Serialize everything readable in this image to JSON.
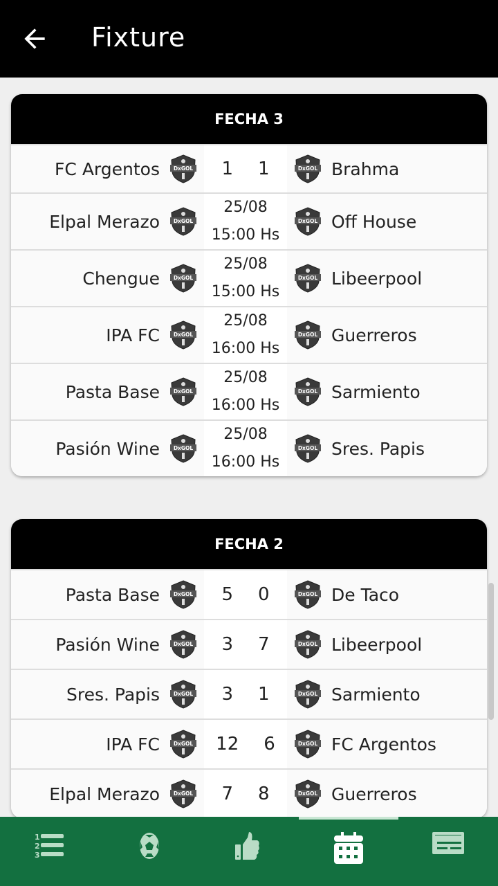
{
  "appbar": {
    "title": "Fixture",
    "back_icon": "arrow-left-icon"
  },
  "rounds": [
    {
      "title": "FECHA 3",
      "matches": [
        {
          "home": "FC Argentos",
          "away": "Brahma",
          "home_score": "1",
          "away_score": "1"
        },
        {
          "home": "Elpal Merazo",
          "away": "Off House",
          "date": "25/08",
          "time": "15:00 Hs"
        },
        {
          "home": "Chengue",
          "away": "Libeerpool",
          "date": "25/08",
          "time": "15:00 Hs"
        },
        {
          "home": "IPA FC",
          "away": "Guerreros",
          "date": "25/08",
          "time": "16:00 Hs"
        },
        {
          "home": "Pasta Base",
          "away": "Sarmiento",
          "date": "25/08",
          "time": "16:00 Hs"
        },
        {
          "home": "Pasión Wine",
          "away": "Sres. Papis",
          "date": "25/08",
          "time": "16:00 Hs"
        }
      ]
    },
    {
      "title": "FECHA 2",
      "matches": [
        {
          "home": "Pasta Base",
          "away": "De Taco",
          "home_score": "5",
          "away_score": "0"
        },
        {
          "home": "Pasión Wine",
          "away": "Libeerpool",
          "home_score": "3",
          "away_score": "7"
        },
        {
          "home": "Sres. Papis",
          "away": "Sarmiento",
          "home_score": "3",
          "away_score": "1"
        },
        {
          "home": "IPA FC",
          "away": "FC Argentos",
          "home_score": "12",
          "away_score": "6"
        },
        {
          "home": "Elpal Merazo",
          "away": "Guerreros",
          "home_score": "7",
          "away_score": "8"
        }
      ]
    }
  ],
  "nav": {
    "items": [
      {
        "icon": "ranking-list-icon"
      },
      {
        "icon": "soccer-ball-icon"
      },
      {
        "icon": "thumbs-up-icon"
      },
      {
        "icon": "calendar-icon",
        "active": true
      },
      {
        "icon": "newspaper-icon"
      }
    ],
    "active_color": "#ffffff",
    "inactive_color": "#b9dcc6",
    "bar_color": "#137040"
  }
}
